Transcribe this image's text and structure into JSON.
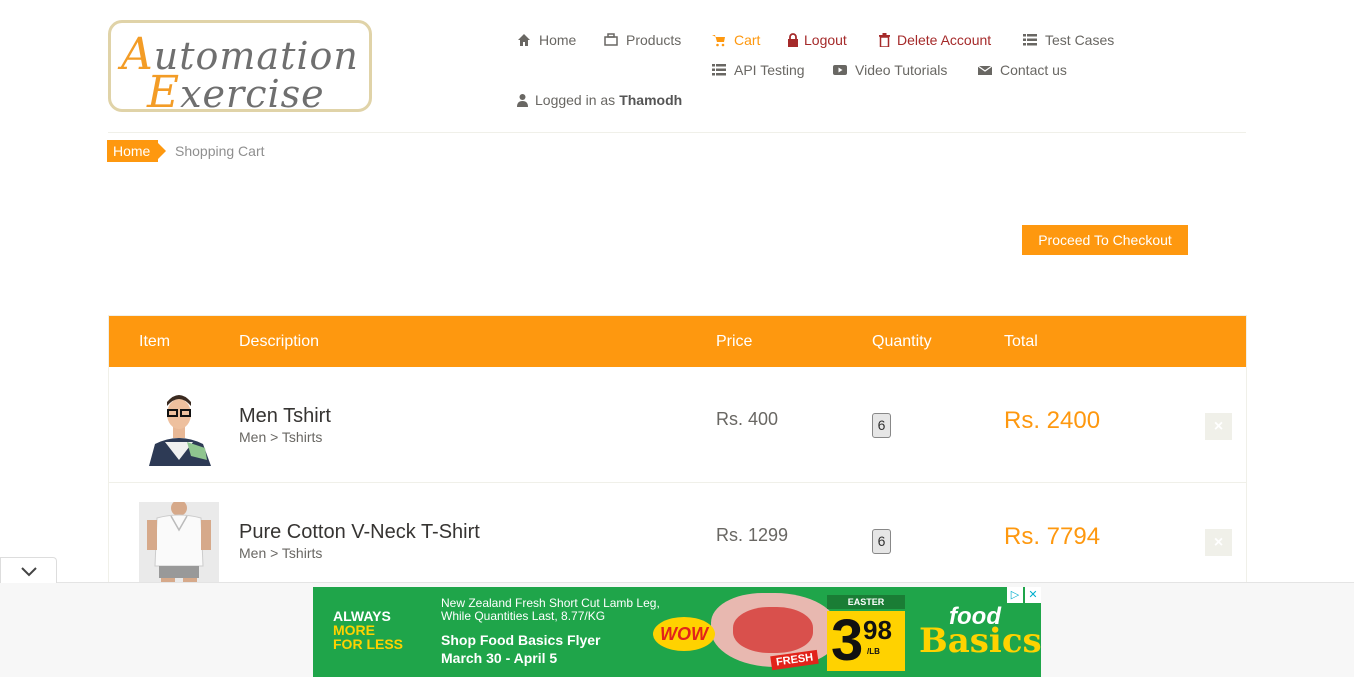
{
  "logo": {
    "line1_big": "A",
    "line1_rest": "utomation",
    "line2_big": "E",
    "line2_rest": "xercise"
  },
  "nav": {
    "home": "Home",
    "products": "Products",
    "cart": "Cart",
    "logout": "Logout",
    "delete_account": "Delete Account",
    "test_cases": "Test Cases",
    "api_testing": "API Testing",
    "video_tutorials": "Video Tutorials",
    "contact_us": "Contact us",
    "logged_in_prefix": "Logged in as",
    "username": "Thamodh"
  },
  "breadcrumb": {
    "home": "Home",
    "current": "Shopping Cart"
  },
  "checkout_button": "Proceed To Checkout",
  "table": {
    "headers": {
      "item": "Item",
      "description": "Description",
      "price": "Price",
      "quantity": "Quantity",
      "total": "Total"
    },
    "rows": [
      {
        "name": "Men Tshirt",
        "category": "Men > Tshirts",
        "price": "Rs. 400",
        "quantity": "6",
        "total": "Rs. 2400",
        "delete": "×"
      },
      {
        "name": "Pure Cotton V-Neck T-Shirt",
        "category": "Men > Tshirts",
        "price": "Rs. 1299",
        "quantity": "6",
        "total": "Rs. 7794",
        "delete": "×"
      }
    ]
  },
  "ad": {
    "always": "ALWAYS",
    "more": "MORE",
    "for_less": "FOR LESS",
    "line1": "New Zealand Fresh Short Cut Lamb Leg,",
    "line2": "While Quantities Last, 8.77/KG",
    "line3": "Shop Food Basics Flyer",
    "line4": "March 30 - April 5",
    "wow": "WOW",
    "fresh": "FRESH",
    "easter": "EASTER SAVINGS",
    "price_main": "3",
    "price_cents": "98",
    "price_unit": "/LB",
    "brand1": "food",
    "brand2": "Basics",
    "close": "✕",
    "adchoices": "▷"
  },
  "colors": {
    "accent": "#fe980f",
    "danger": "#a52a2a",
    "ad_green": "#1fa54a",
    "ad_yellow": "#ffd200"
  }
}
